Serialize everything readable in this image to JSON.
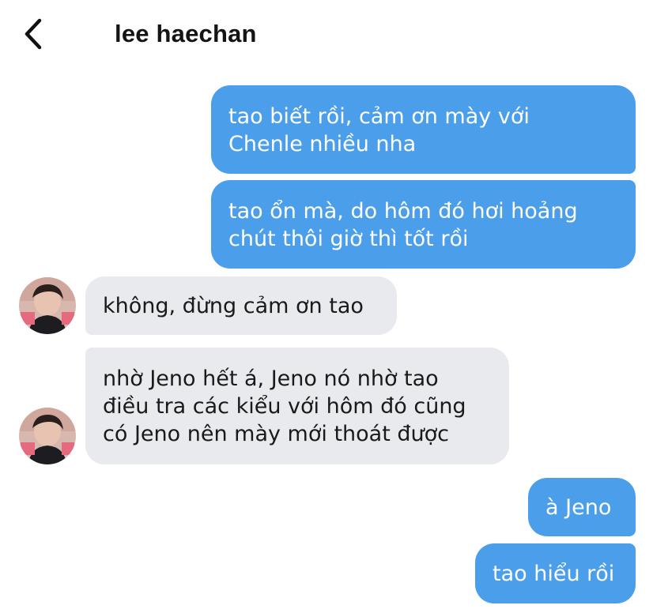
{
  "header": {
    "back_icon": "chevron-left-icon",
    "title": "lee haechan"
  },
  "messages": [
    {
      "sender": "me",
      "text": "tao biết rồi, cảm ơn mày với\nChenle nhiều nha"
    },
    {
      "sender": "me",
      "text": "tao ổn mà, do hôm đó hơi hoảng\nchút thôi giờ thì tốt rồi"
    },
    {
      "sender": "them",
      "text": "không, đừng cảm ơn tao"
    },
    {
      "sender": "them",
      "text": "nhờ Jeno hết á, Jeno nó nhờ tao\nđiều tra các kiểu với hôm đó cũng\ncó Jeno nên mày mới thoát được"
    },
    {
      "sender": "me",
      "text": "à Jeno"
    },
    {
      "sender": "me",
      "text": "tao hiểu rồi"
    }
  ],
  "colors": {
    "outgoing_bubble": "#4b9eea",
    "incoming_bubble": "#e8eaee"
  }
}
